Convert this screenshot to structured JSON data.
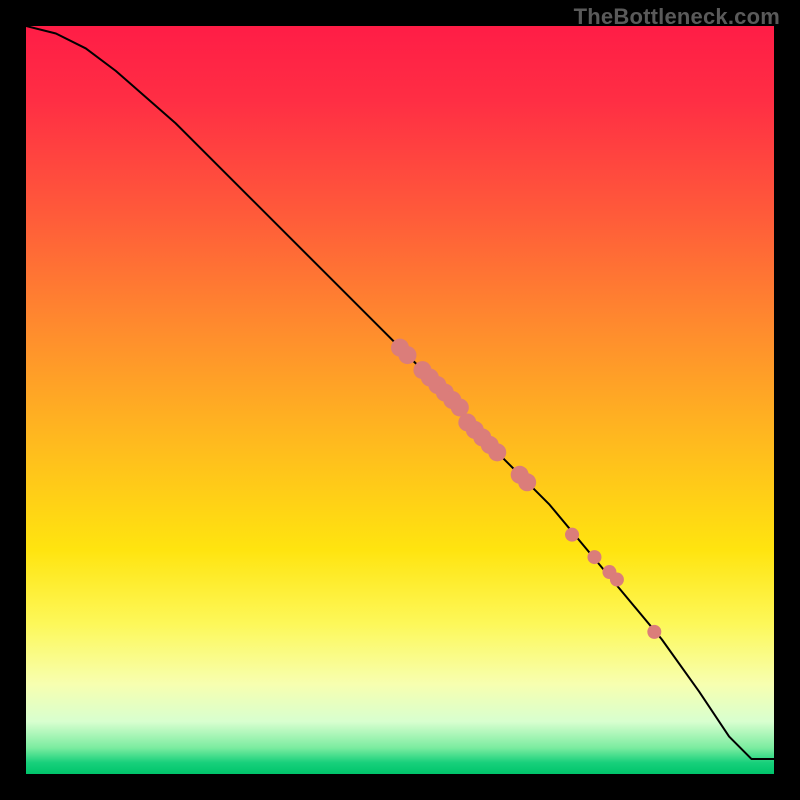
{
  "watermark": "TheBottleneck.com",
  "gradient_stops": [
    {
      "offset": 0.0,
      "color": "#ff1d46"
    },
    {
      "offset": 0.1,
      "color": "#ff2e44"
    },
    {
      "offset": 0.25,
      "color": "#ff5a3a"
    },
    {
      "offset": 0.4,
      "color": "#ff8a2e"
    },
    {
      "offset": 0.55,
      "color": "#ffb81f"
    },
    {
      "offset": 0.7,
      "color": "#ffe40f"
    },
    {
      "offset": 0.8,
      "color": "#fdf85a"
    },
    {
      "offset": 0.88,
      "color": "#f7ffb0"
    },
    {
      "offset": 0.93,
      "color": "#d8ffcf"
    },
    {
      "offset": 0.965,
      "color": "#7beca0"
    },
    {
      "offset": 0.985,
      "color": "#17d07b"
    },
    {
      "offset": 1.0,
      "color": "#00c46b"
    }
  ],
  "curve_color": "#000000",
  "marker_color": "#db7d7a",
  "marker_radius_big": 9,
  "marker_radius_small": 7,
  "chart_data": {
    "type": "line",
    "title": "",
    "xlabel": "",
    "ylabel": "",
    "xlim": [
      0,
      100
    ],
    "ylim": [
      0,
      100
    ],
    "grid": false,
    "legend": false,
    "series": [
      {
        "name": "curve",
        "x": [
          0,
          4,
          8,
          12,
          20,
          30,
          40,
          50,
          55,
          60,
          65,
          70,
          75,
          80,
          85,
          90,
          94,
          97,
          100
        ],
        "y": [
          100,
          99,
          97,
          94,
          87,
          77,
          67,
          57,
          52,
          46,
          41,
          36,
          30,
          24,
          18,
          11,
          5,
          2,
          2
        ]
      }
    ],
    "markers": [
      {
        "x": 50,
        "y": 57,
        "r": "big"
      },
      {
        "x": 51,
        "y": 56,
        "r": "big"
      },
      {
        "x": 53,
        "y": 54,
        "r": "big"
      },
      {
        "x": 54,
        "y": 53,
        "r": "big"
      },
      {
        "x": 55,
        "y": 52,
        "r": "big"
      },
      {
        "x": 56,
        "y": 51,
        "r": "big"
      },
      {
        "x": 57,
        "y": 50,
        "r": "big"
      },
      {
        "x": 58,
        "y": 49,
        "r": "big"
      },
      {
        "x": 59,
        "y": 47,
        "r": "big"
      },
      {
        "x": 60,
        "y": 46,
        "r": "big"
      },
      {
        "x": 61,
        "y": 45,
        "r": "big"
      },
      {
        "x": 62,
        "y": 44,
        "r": "big"
      },
      {
        "x": 63,
        "y": 43,
        "r": "big"
      },
      {
        "x": 66,
        "y": 40,
        "r": "big"
      },
      {
        "x": 67,
        "y": 39,
        "r": "big"
      },
      {
        "x": 73,
        "y": 32,
        "r": "small"
      },
      {
        "x": 76,
        "y": 29,
        "r": "small"
      },
      {
        "x": 78,
        "y": 27,
        "r": "small"
      },
      {
        "x": 79,
        "y": 26,
        "r": "small"
      },
      {
        "x": 84,
        "y": 19,
        "r": "small"
      }
    ],
    "annotations": []
  }
}
